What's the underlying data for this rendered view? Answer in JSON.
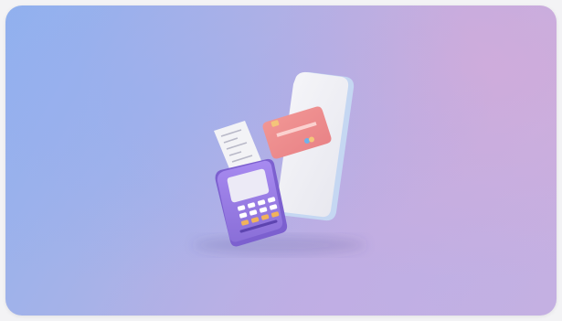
{
  "image": {
    "description_icons": [
      "payment-terminal-icon",
      "receipt-icon",
      "credit-card-icon",
      "smartphone-icon"
    ],
    "colors": {
      "background_left": "#8fb1ee",
      "background_right": "#c9b1df",
      "terminal": "#9a7ee6",
      "terminal_screen": "#eceaf6",
      "keypad_keys": "#ffffff",
      "keypad_accent_keys": "#f2b35a",
      "card": "#f08b8a",
      "phone": "#f1f1f5",
      "phone_edge": "#bcd2f0",
      "receipt": "#f4f4f6"
    }
  }
}
